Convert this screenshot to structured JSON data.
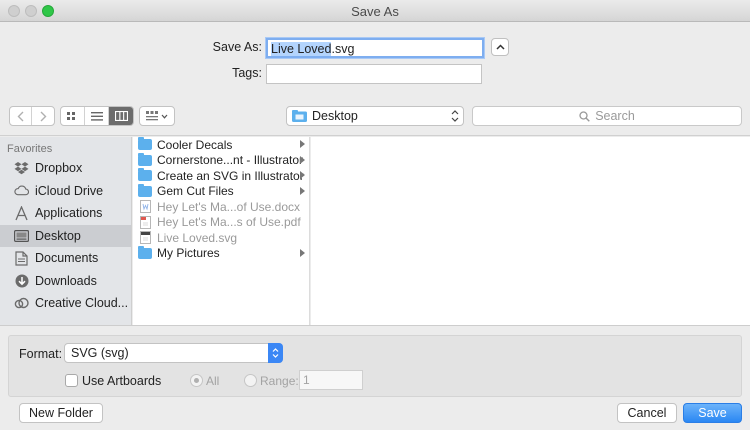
{
  "window": {
    "title": "Save As"
  },
  "top": {
    "save_as_label": "Save As:",
    "filename_selected": "Live Loved",
    "filename_ext": ".svg",
    "tags_label": "Tags:",
    "tags_value": ""
  },
  "toolbar": {
    "location": "Desktop",
    "search_placeholder": "Search"
  },
  "sidebar": {
    "header": "Favorites",
    "items": [
      {
        "label": "Dropbox",
        "icon": "dropbox-icon"
      },
      {
        "label": "iCloud Drive",
        "icon": "cloud-icon"
      },
      {
        "label": "Applications",
        "icon": "applications-icon"
      },
      {
        "label": "Desktop",
        "icon": "desktop-icon",
        "selected": true
      },
      {
        "label": "Documents",
        "icon": "documents-icon"
      },
      {
        "label": "Downloads",
        "icon": "downloads-icon"
      },
      {
        "label": "Creative Cloud...",
        "icon": "creative-cloud-icon"
      }
    ]
  },
  "files": [
    {
      "name": "Cooler Decals",
      "type": "folder",
      "dim": false
    },
    {
      "name": "Cornerstone...nt - Illustrator",
      "type": "folder",
      "dim": false
    },
    {
      "name": "Create an SVG in Illustrator",
      "type": "folder",
      "dim": false
    },
    {
      "name": "Gem Cut Files",
      "type": "folder",
      "dim": false
    },
    {
      "name": "Hey Let's Ma...of Use.docx",
      "type": "doc",
      "dim": true
    },
    {
      "name": "Hey Let's Ma...s of Use.pdf",
      "type": "pdf",
      "dim": true
    },
    {
      "name": "Live Loved.svg",
      "type": "svg",
      "dim": true
    },
    {
      "name": "My Pictures",
      "type": "folder",
      "dim": false
    }
  ],
  "format": {
    "label": "Format:",
    "selected": "SVG (svg)",
    "use_artboards_label": "Use Artboards",
    "all_label": "All",
    "range_label": "Range:",
    "range_value": "1"
  },
  "buttons": {
    "new_folder": "New Folder",
    "cancel": "Cancel",
    "save": "Save"
  },
  "colors": {
    "accent": "#2a87f3",
    "folder": "#5cb0ed",
    "selection": "#b3d4fd"
  }
}
